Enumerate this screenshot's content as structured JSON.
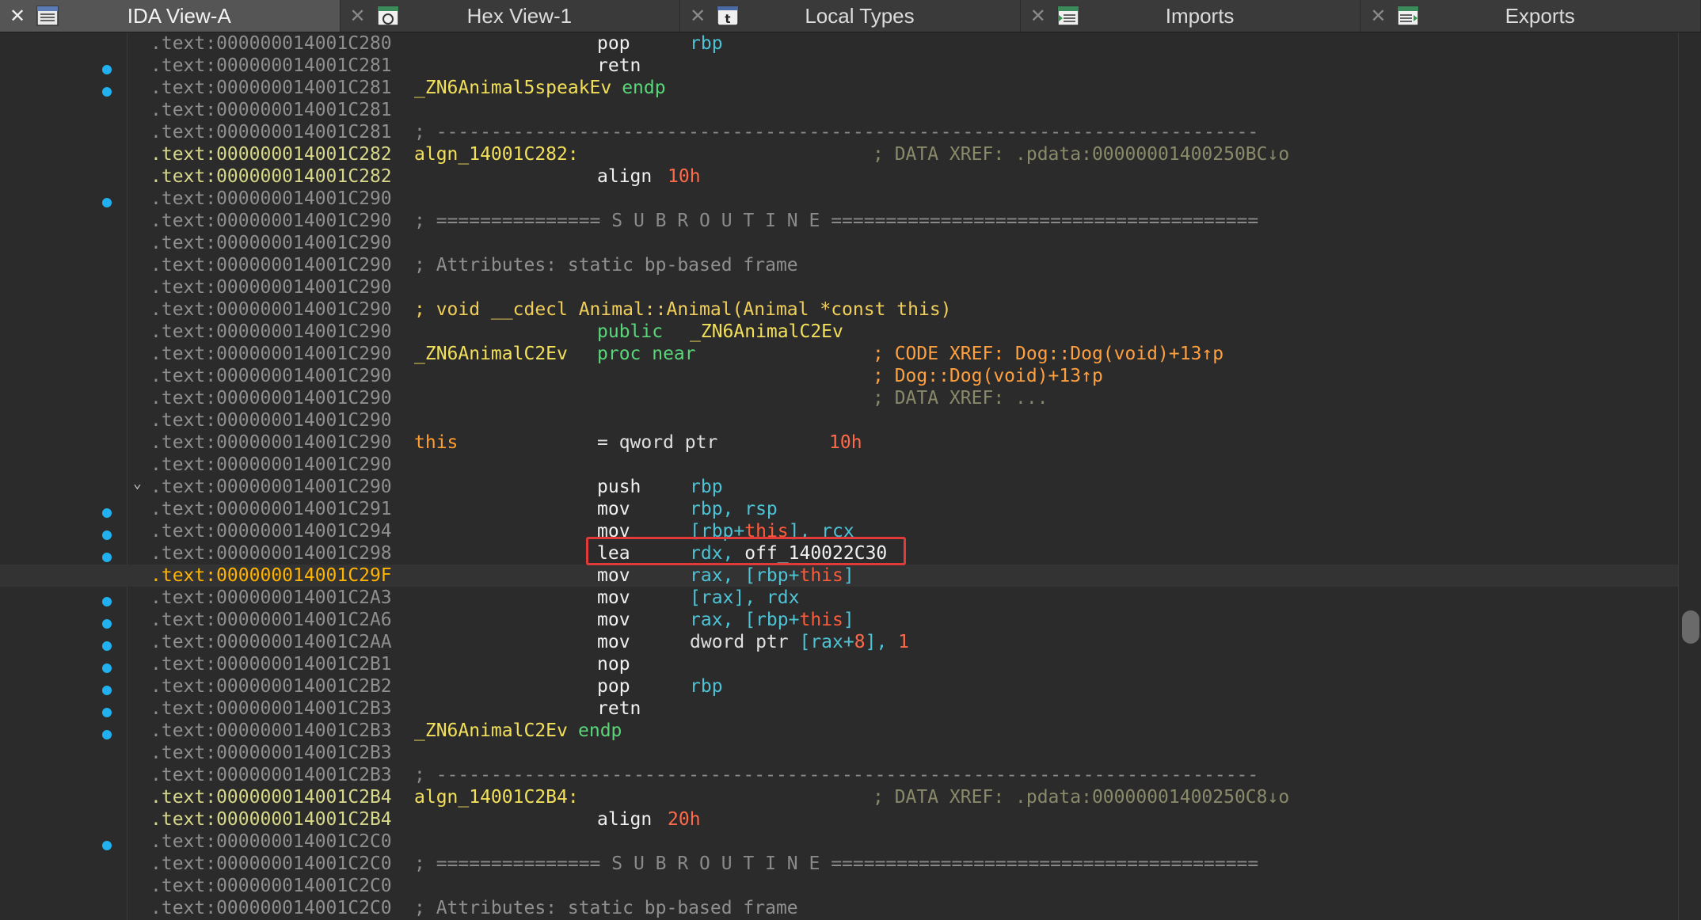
{
  "tabs": [
    {
      "label": "IDA View-A",
      "icon": "ida-view-icon",
      "active": true
    },
    {
      "label": "Hex View-1",
      "icon": "hex-view-icon",
      "active": false
    },
    {
      "label": "Local Types",
      "icon": "local-types-icon",
      "active": false
    },
    {
      "label": "Imports",
      "icon": "imports-icon",
      "active": false
    },
    {
      "label": "Exports",
      "icon": "exports-icon",
      "active": false
    }
  ],
  "close_glyph": "✕",
  "fold_glyph": "⌄",
  "lines": [
    {
      "addr": ".text:000000014001C280",
      "mnem": "pop",
      "ops": "rbp"
    },
    {
      "addr": ".text:000000014001C281",
      "mnem": "retn"
    },
    {
      "addr": ".text:000000014001C281",
      "label": "_ZN6Animal5speakEv",
      "label_mnem": "endp"
    },
    {
      "addr": ".text:000000014001C281"
    },
    {
      "addr": ".text:000000014001C281",
      "sep": "; ---------------------------------------------------------------------------"
    },
    {
      "addr": ".text:000000014001C282",
      "label": "algn_14001C282:",
      "comment": "; DATA XREF: .pdata:00000001400250BC↓o",
      "hl": true
    },
    {
      "addr": ".text:000000014001C282",
      "mnem": "align",
      "num": "10h",
      "hl": true
    },
    {
      "addr": ".text:000000014001C290"
    },
    {
      "addr": ".text:000000014001C290",
      "sep": "; =============== S U B R O U T I N E ======================================="
    },
    {
      "addr": ".text:000000014001C290"
    },
    {
      "addr": ".text:000000014001C290",
      "attr": "; Attributes: static bp-based frame"
    },
    {
      "addr": ".text:000000014001C290"
    },
    {
      "addr": ".text:000000014001C290",
      "proto": "; void __cdecl Animal::Animal(Animal *const this)"
    },
    {
      "addr": ".text:000000014001C290",
      "mnem_kw": "public",
      "ops_label": "_ZN6AnimalC2Ev"
    },
    {
      "addr": ".text:000000014001C290",
      "label": "_ZN6AnimalC2Ev",
      "mnem_kw": "proc near",
      "comment_code": "; CODE XREF: Dog::Dog(void)+13↑p"
    },
    {
      "addr": ".text:000000014001C290",
      "comment_code": "; Dog::Dog(void)+13↑p"
    },
    {
      "addr": ".text:000000014001C290",
      "comment": "; DATA XREF: ..."
    },
    {
      "addr": ".text:000000014001C290"
    },
    {
      "addr": ".text:000000014001C290",
      "var": "this",
      "var_def": "= qword ptr  ",
      "num2": "10h"
    },
    {
      "addr": ".text:000000014001C290"
    },
    {
      "addr": ".text:000000014001C290",
      "mnem": "push",
      "ops": "rbp"
    },
    {
      "addr": ".text:000000014001C291",
      "mnem": "mov",
      "ops": "rbp, rsp"
    },
    {
      "addr": ".text:000000014001C294",
      "mnem": "mov",
      "ops_parts": [
        "[rbp+",
        "this",
        "], rcx"
      ]
    },
    {
      "addr": ".text:000000014001C298",
      "mnem": "lea",
      "ops_mixed": [
        "rdx, ",
        "off_140022C30"
      ]
    },
    {
      "addr": ".text:000000014001C29F",
      "mnem": "mov",
      "ops_parts": [
        "rax, [rbp+",
        "this",
        "]"
      ],
      "current": true
    },
    {
      "addr": ".text:000000014001C2A3",
      "mnem": "mov",
      "ops": "[rax], rdx"
    },
    {
      "addr": ".text:000000014001C2A6",
      "mnem": "mov",
      "ops_parts": [
        "rax, [rbp+",
        "this",
        "]"
      ]
    },
    {
      "addr": ".text:000000014001C2AA",
      "mnem": "mov",
      "ops_dword": [
        "dword ptr ",
        "[rax+",
        "8",
        "], ",
        "1"
      ]
    },
    {
      "addr": ".text:000000014001C2B1",
      "mnem": "nop"
    },
    {
      "addr": ".text:000000014001C2B2",
      "mnem": "pop",
      "ops": "rbp"
    },
    {
      "addr": ".text:000000014001C2B3",
      "mnem": "retn"
    },
    {
      "addr": ".text:000000014001C2B3",
      "label": "_ZN6AnimalC2Ev",
      "label_mnem": "endp"
    },
    {
      "addr": ".text:000000014001C2B3"
    },
    {
      "addr": ".text:000000014001C2B3",
      "sep": "; ---------------------------------------------------------------------------"
    },
    {
      "addr": ".text:000000014001C2B4",
      "label": "algn_14001C2B4:",
      "comment": "; DATA XREF: .pdata:00000001400250C8↓o",
      "hl": true
    },
    {
      "addr": ".text:000000014001C2B4",
      "mnem": "align",
      "num": "20h",
      "hl": true
    },
    {
      "addr": ".text:000000014001C2C0"
    },
    {
      "addr": ".text:000000014001C2C0",
      "sep": "; =============== S U B R O U T I N E ======================================="
    },
    {
      "addr": ".text:000000014001C2C0"
    },
    {
      "addr": ".text:000000014001C2C0",
      "attr": "; Attributes: static bp-based frame"
    }
  ]
}
